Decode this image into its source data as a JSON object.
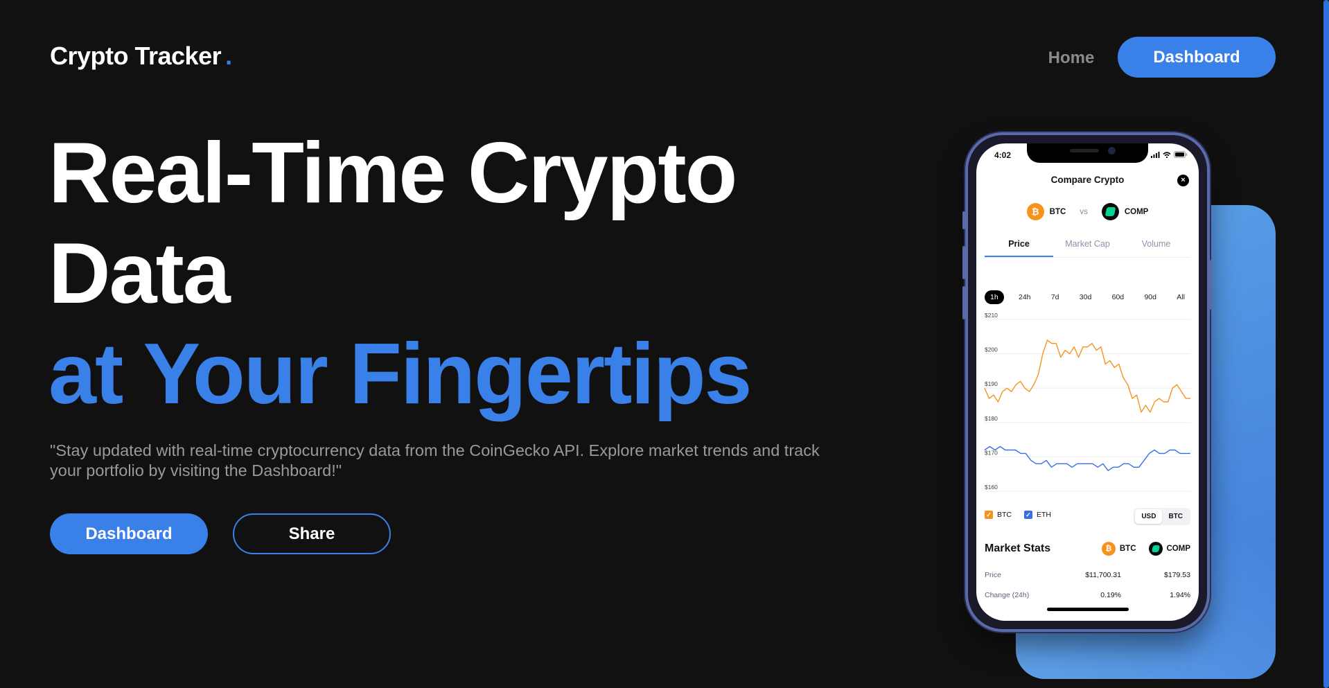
{
  "header": {
    "logo_text": "Crypto Tracker",
    "logo_dot": ".",
    "nav_home": "Home",
    "nav_dashboard": "Dashboard"
  },
  "hero": {
    "line1": "Real-Time Crypto",
    "line2": "Data",
    "line3": "at Your Fingertips",
    "description": "\"Stay updated with real-time cryptocurrency data from the CoinGecko API. Explore market trends and track your portfolio by visiting the Dashboard!\"",
    "primary_button": "Dashboard",
    "secondary_button": "Share"
  },
  "colors": {
    "background": "#111111",
    "accent": "#3a80e9",
    "btc": "#f7931a",
    "eth_line": "#3a6ee8",
    "comp": "#00d395"
  },
  "phone": {
    "status_time": "4:02",
    "modal_title": "Compare Crypto",
    "close_icon": "×",
    "coin_a": "BTC",
    "vs": "vs",
    "coin_b": "COMP",
    "tabs": [
      {
        "label": "Price",
        "active": true
      },
      {
        "label": "Market Cap",
        "active": false
      },
      {
        "label": "Volume",
        "active": false
      }
    ],
    "ranges": [
      "1h",
      "24h",
      "7d",
      "30d",
      "60d",
      "90d",
      "All"
    ],
    "active_range": "1h",
    "legend": [
      {
        "label": "BTC",
        "checked": true
      },
      {
        "label": "ETH",
        "checked": true
      }
    ],
    "currency_toggle": [
      "USD",
      "BTC"
    ],
    "active_currency": "USD",
    "stats": {
      "title": "Market Stats",
      "col_a": "BTC",
      "col_b": "COMP",
      "rows": [
        {
          "label": "Price",
          "a": "$11,700.31",
          "b": "$179.53"
        },
        {
          "label": "Change (24h)",
          "a": "0.19%",
          "b": "1.94%"
        }
      ]
    }
  },
  "chart_data": {
    "type": "line",
    "yticks": [
      "$210",
      "$200",
      "$190",
      "$180",
      "$170",
      "$160"
    ],
    "ylim": [
      160,
      210
    ],
    "grid": true,
    "series": [
      {
        "name": "BTC",
        "color": "#f7931a",
        "values": [
          190,
          187,
          188,
          186,
          189,
          190,
          189,
          191,
          192,
          190,
          189,
          191,
          194,
          200,
          204,
          203,
          203,
          199,
          201,
          200,
          202,
          199,
          202,
          202,
          203,
          201,
          202,
          197,
          198,
          196,
          197,
          193,
          191,
          187,
          188,
          183,
          185,
          183,
          186,
          187,
          186,
          186,
          190,
          191,
          189,
          187,
          187
        ]
      },
      {
        "name": "ETH",
        "color": "#3a6ee8",
        "values": [
          172,
          173,
          172,
          173,
          172,
          172,
          172,
          171,
          171,
          169,
          168,
          168,
          169,
          167,
          168,
          168,
          168,
          167,
          168,
          168,
          168,
          168,
          167,
          168,
          166,
          167,
          167,
          168,
          168,
          167,
          167,
          169,
          171,
          172,
          171,
          171,
          172,
          172,
          171,
          171,
          171
        ]
      }
    ]
  }
}
